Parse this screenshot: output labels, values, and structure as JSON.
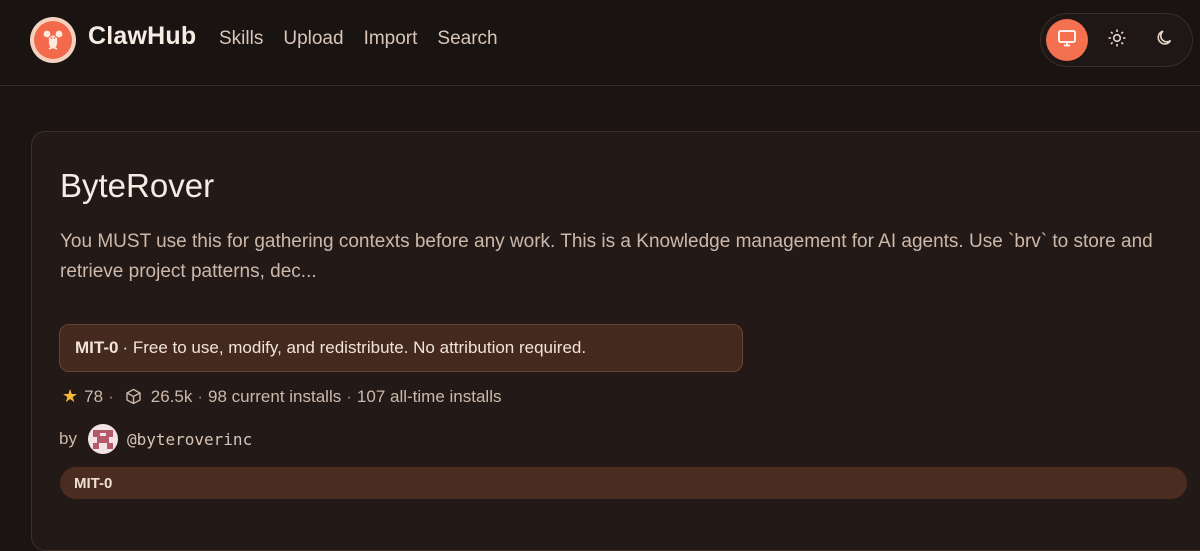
{
  "brand": {
    "name": "ClawHub",
    "logo_icon": "lobster-icon"
  },
  "nav": {
    "items": [
      "Skills",
      "Upload",
      "Import",
      "Search"
    ]
  },
  "theme": {
    "options": [
      "system-monitor-icon",
      "sun-icon",
      "moon-icon"
    ],
    "selected": "system-monitor-icon",
    "accent": "#f4704f"
  },
  "skill": {
    "title": "ByteRover",
    "description": "You MUST use this for gathering contexts before any work. This is a Knowledge management for AI agents. Use `brv` to store and retrieve project patterns, dec...",
    "license": {
      "name": "MIT-0",
      "text": "· Free to use, modify, and redistribute. No attribution required."
    },
    "stats": {
      "stars": "78",
      "downloads": "26.5k",
      "current_installs": "98 current installs",
      "all_time_installs": "107 all-time installs"
    },
    "author": {
      "by_label": "by",
      "handle": "@byteroverinc"
    },
    "tag": "MIT-0"
  }
}
